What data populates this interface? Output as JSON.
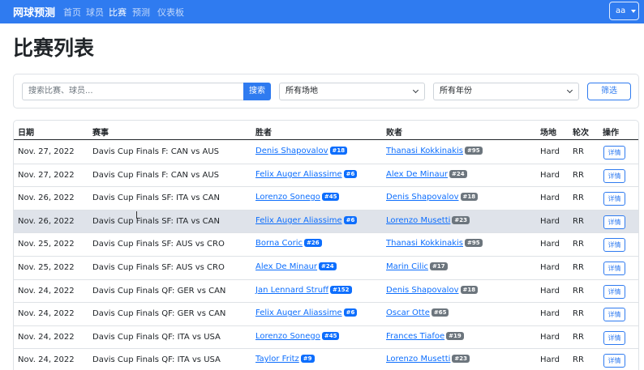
{
  "navbar": {
    "brand": "网球预测",
    "links": [
      "首页",
      "球员",
      "比赛",
      "预测",
      "仪表板"
    ],
    "active_index": 2,
    "user_label": "aa"
  },
  "page_title": "比赛列表",
  "filters": {
    "search_placeholder": "搜索比赛、球员...",
    "search_button": "搜索",
    "surface_select": "所有场地",
    "year_select": "所有年份",
    "filter_button": "筛选"
  },
  "table": {
    "headers": [
      "日期",
      "赛事",
      "胜者",
      "败者",
      "场地",
      "轮次",
      "操作"
    ],
    "rows": [
      {
        "date": "Nov. 27, 2022",
        "event": "Davis Cup Finals F: CAN vs AUS",
        "winner": "Denis Shapovalov",
        "winner_rank": "#18",
        "loser": "Thanasi Kokkinakis",
        "loser_rank": "#95",
        "surface": "Hard",
        "round": "RR",
        "action": "详情"
      },
      {
        "date": "Nov. 27, 2022",
        "event": "Davis Cup Finals F: CAN vs AUS",
        "winner": "Felix Auger Aliassime",
        "winner_rank": "#6",
        "loser": "Alex De Minaur",
        "loser_rank": "#24",
        "surface": "Hard",
        "round": "RR",
        "action": "详情"
      },
      {
        "date": "Nov. 26, 2022",
        "event": "Davis Cup Finals SF: ITA vs CAN",
        "winner": "Lorenzo Sonego",
        "winner_rank": "#45",
        "loser": "Denis Shapovalov",
        "loser_rank": "#18",
        "surface": "Hard",
        "round": "RR",
        "action": "详情"
      },
      {
        "date": "Nov. 26, 2022",
        "event": "Davis Cup Finals SF: ITA vs CAN",
        "winner": "Felix Auger Aliassime",
        "winner_rank": "#6",
        "loser": "Lorenzo Musetti",
        "loser_rank": "#23",
        "surface": "Hard",
        "round": "RR",
        "action": "详情"
      },
      {
        "date": "Nov. 25, 2022",
        "event": "Davis Cup Finals SF: AUS vs CRO",
        "winner": "Borna Coric",
        "winner_rank": "#26",
        "loser": "Thanasi Kokkinakis",
        "loser_rank": "#95",
        "surface": "Hard",
        "round": "RR",
        "action": "详情"
      },
      {
        "date": "Nov. 25, 2022",
        "event": "Davis Cup Finals SF: AUS vs CRO",
        "winner": "Alex De Minaur",
        "winner_rank": "#24",
        "loser": "Marin Cilic",
        "loser_rank": "#17",
        "surface": "Hard",
        "round": "RR",
        "action": "详情"
      },
      {
        "date": "Nov. 24, 2022",
        "event": "Davis Cup Finals QF: GER vs CAN",
        "winner": "Jan Lennard Struff",
        "winner_rank": "#152",
        "loser": "Denis Shapovalov",
        "loser_rank": "#18",
        "surface": "Hard",
        "round": "RR",
        "action": "详情"
      },
      {
        "date": "Nov. 24, 2022",
        "event": "Davis Cup Finals QF: GER vs CAN",
        "winner": "Felix Auger Aliassime",
        "winner_rank": "#6",
        "loser": "Oscar Otte",
        "loser_rank": "#65",
        "surface": "Hard",
        "round": "RR",
        "action": "详情"
      },
      {
        "date": "Nov. 24, 2022",
        "event": "Davis Cup Finals QF: ITA vs USA",
        "winner": "Lorenzo Sonego",
        "winner_rank": "#45",
        "loser": "Frances Tiafoe",
        "loser_rank": "#19",
        "surface": "Hard",
        "round": "RR",
        "action": "详情"
      },
      {
        "date": "Nov. 24, 2022",
        "event": "Davis Cup Finals QF: ITA vs USA",
        "winner": "Taylor Fritz",
        "winner_rank": "#9",
        "loser": "Lorenzo Musetti",
        "loser_rank": "#23",
        "surface": "Hard",
        "round": "RR",
        "action": "详情"
      }
    ]
  },
  "colors": {
    "primary": "#2f7bf0",
    "link": "#0d6efd",
    "badge_grey": "#6c757d",
    "row_highlight": "#dfe3ea"
  }
}
